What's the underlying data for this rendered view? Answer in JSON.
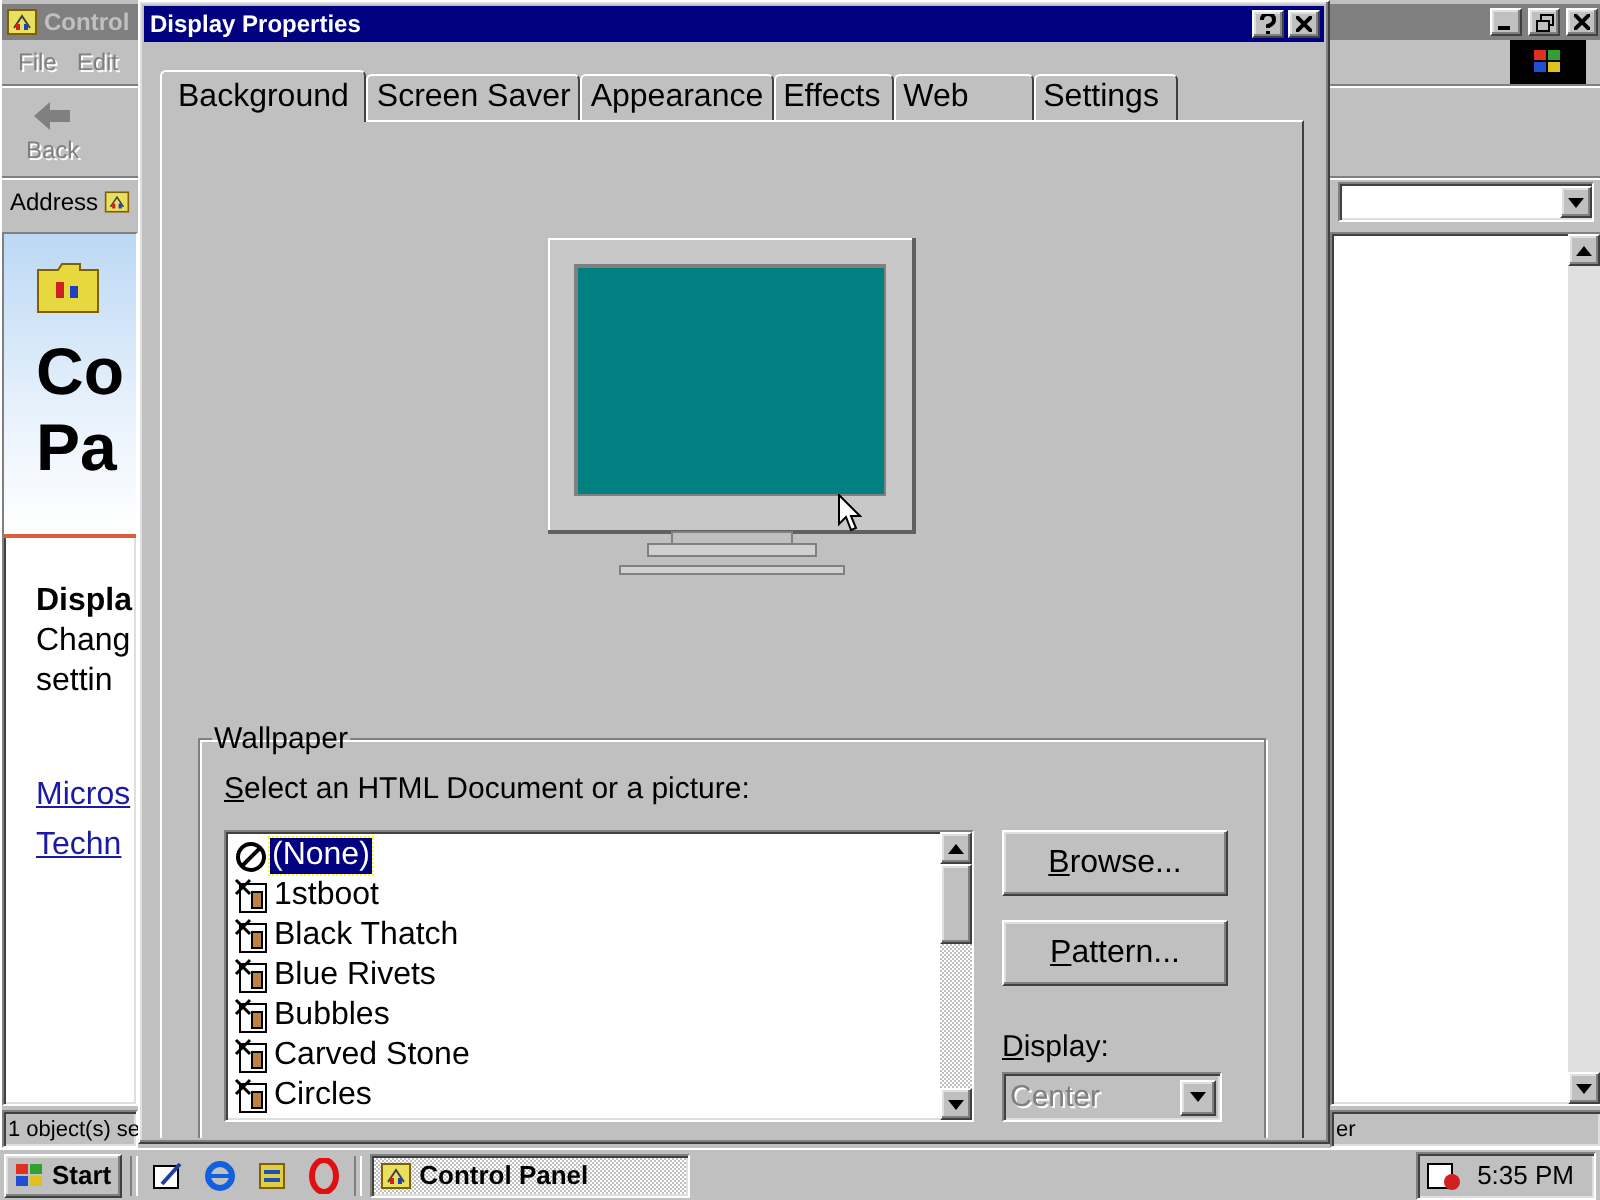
{
  "background_window": {
    "title": "Control",
    "menu": [
      "File",
      "Edit"
    ],
    "toolbar": [
      {
        "label": "Back",
        "disabled": true
      }
    ],
    "address_label": "Address",
    "content": {
      "heading_lines": [
        "Co",
        "Pa"
      ],
      "item_title": "Displa",
      "item_description_lines": [
        "Chang",
        "settin"
      ],
      "links": [
        "Micros",
        "Techn"
      ]
    },
    "status_bar": [
      "1 object(s) se",
      "er"
    ]
  },
  "dialog": {
    "title": "Display Properties",
    "tabs": [
      {
        "label": "Background",
        "selected": true
      },
      {
        "label": "Screen Saver",
        "selected": false
      },
      {
        "label": "Appearance",
        "selected": false
      },
      {
        "label": "Effects",
        "selected": false
      },
      {
        "label": "Web",
        "selected": false
      },
      {
        "label": "Settings",
        "selected": false
      }
    ],
    "wallpaper": {
      "group_label": "Wallpaper",
      "list_label": "Select an HTML Document or a picture:",
      "items": [
        {
          "label": "(None)",
          "kind": "none",
          "selected": true
        },
        {
          "label": "1stboot",
          "kind": "image",
          "selected": false
        },
        {
          "label": "Black Thatch",
          "kind": "image",
          "selected": false
        },
        {
          "label": "Blue Rivets",
          "kind": "image",
          "selected": false
        },
        {
          "label": "Bubbles",
          "kind": "image",
          "selected": false
        },
        {
          "label": "Carved Stone",
          "kind": "image",
          "selected": false
        },
        {
          "label": "Circles",
          "kind": "image",
          "selected": false
        }
      ],
      "buttons": [
        "Browse...",
        "Pattern..."
      ],
      "display_label": "Display:",
      "display": {
        "value": "Center",
        "disabled": true
      }
    }
  },
  "taskbar": {
    "start": "Start",
    "tasks": [
      {
        "label": "Control Panel",
        "selected": true
      }
    ],
    "clock": "5:35 PM"
  }
}
